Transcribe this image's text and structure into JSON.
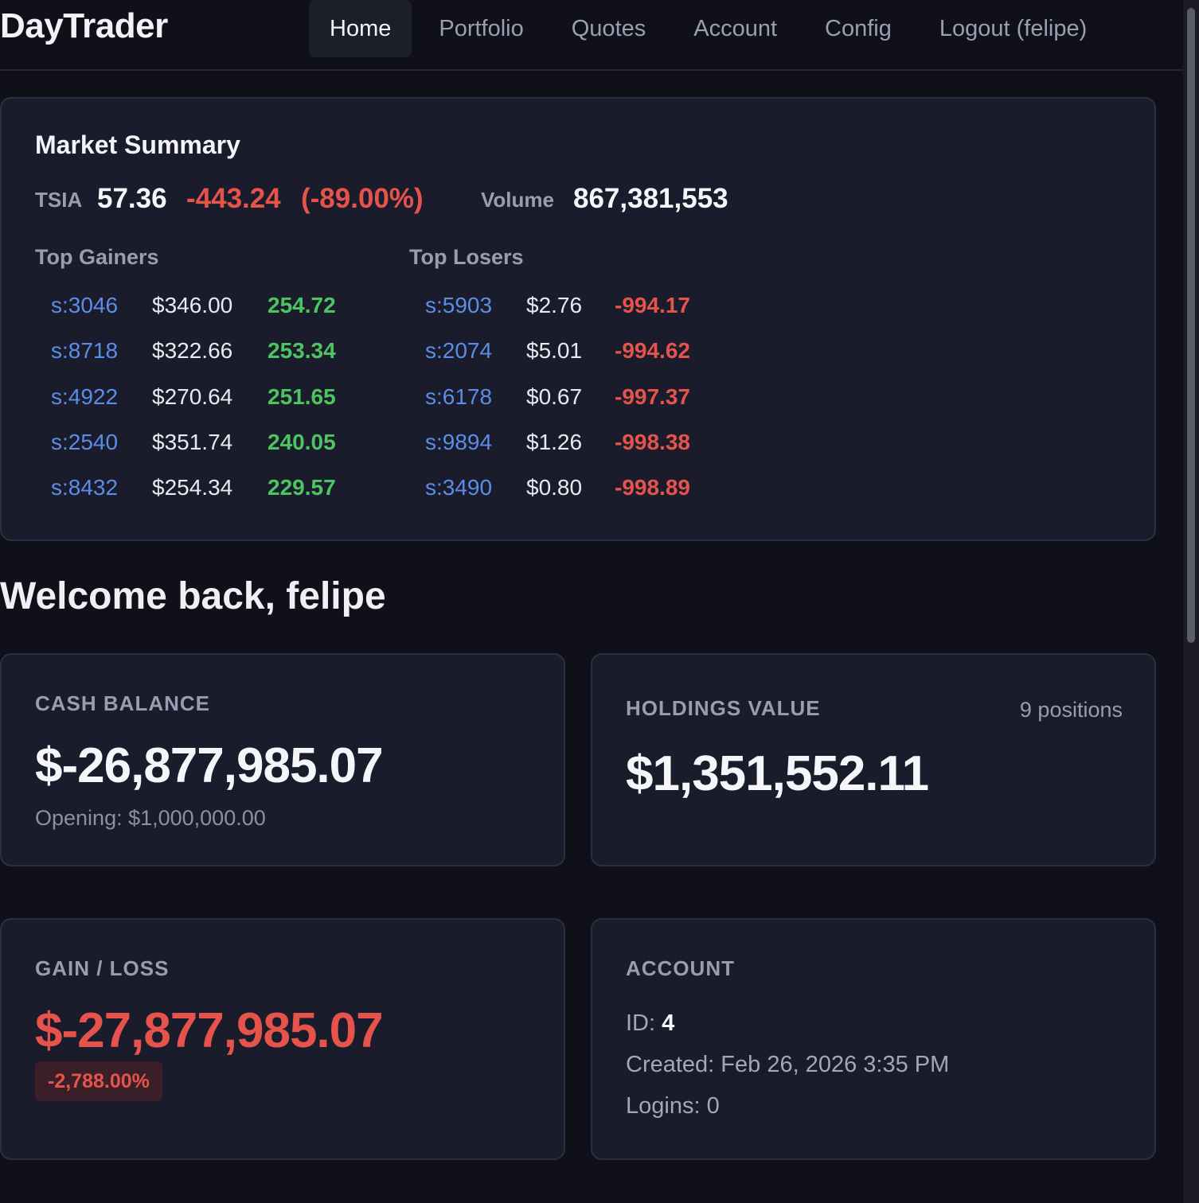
{
  "brand": "DayTrader",
  "nav": [
    {
      "label": "Home",
      "active": true
    },
    {
      "label": "Portfolio"
    },
    {
      "label": "Quotes"
    },
    {
      "label": "Account"
    },
    {
      "label": "Config"
    },
    {
      "label": "Logout (felipe)"
    }
  ],
  "market_summary": {
    "title": "Market Summary",
    "tsia_label": "TSIA",
    "tsia_value": "57.36",
    "tsia_change": "-443.24",
    "tsia_change_pct": "(-89.00%)",
    "volume_label": "Volume",
    "volume_value": "867,381,553",
    "top_gainers_title": "Top Gainers",
    "top_losers_title": "Top Losers",
    "top_gainers": [
      {
        "symbol": "s:3046",
        "price": "$346.00",
        "change": "254.72"
      },
      {
        "symbol": "s:8718",
        "price": "$322.66",
        "change": "253.34"
      },
      {
        "symbol": "s:4922",
        "price": "$270.64",
        "change": "251.65"
      },
      {
        "symbol": "s:2540",
        "price": "$351.74",
        "change": "240.05"
      },
      {
        "symbol": "s:8432",
        "price": "$254.34",
        "change": "229.57"
      }
    ],
    "top_losers": [
      {
        "symbol": "s:5903",
        "price": "$2.76",
        "change": "-994.17"
      },
      {
        "symbol": "s:2074",
        "price": "$5.01",
        "change": "-994.62"
      },
      {
        "symbol": "s:6178",
        "price": "$0.67",
        "change": "-997.37"
      },
      {
        "symbol": "s:9894",
        "price": "$1.26",
        "change": "-998.38"
      },
      {
        "symbol": "s:3490",
        "price": "$0.80",
        "change": "-998.89"
      }
    ]
  },
  "welcome": "Welcome back, felipe",
  "cash_balance": {
    "label": "CASH BALANCE",
    "value": "$-26,877,985.07",
    "opening": "Opening: $1,000,000.00"
  },
  "holdings_value": {
    "label": "HOLDINGS VALUE",
    "positions": "9 positions",
    "value": "$1,351,552.11"
  },
  "gain_loss": {
    "label": "GAIN / LOSS",
    "value": "$-27,877,985.07",
    "percent": "-2,788.00%"
  },
  "account": {
    "label": "ACCOUNT",
    "id_label": "ID:",
    "id_value": "4",
    "created": "Created: Feb 26, 2026 3:35 PM",
    "logins": "Logins: 0"
  },
  "colors": {
    "background": "#0f1019",
    "card": "#1a1c2c",
    "accent_link": "#5b8de8",
    "gain": "#4cc561",
    "loss": "#e5534b"
  }
}
